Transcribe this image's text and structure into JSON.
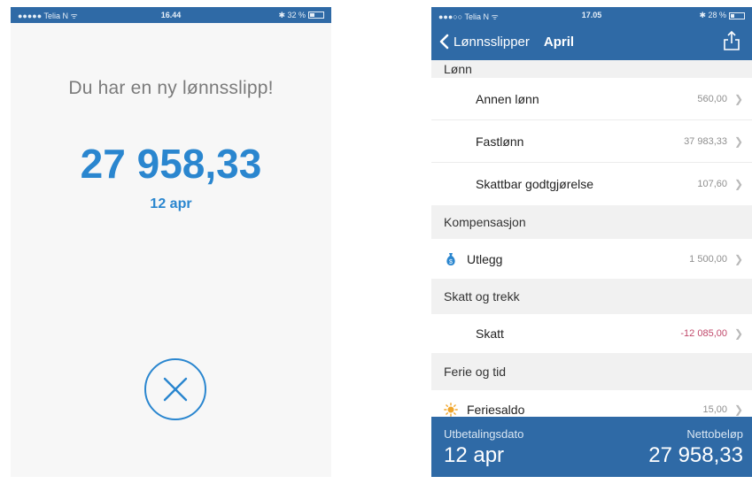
{
  "left": {
    "status": {
      "carrier": "●●●●● Telia N ᯤ",
      "time": "16.44",
      "battery": "✱ 32 %",
      "battery_level": 0.32
    },
    "message": "Du har en ny lønnsslipp!",
    "amount": "27 958,33",
    "date": "12 apr",
    "close_icon": "close-circle-icon"
  },
  "right": {
    "status": {
      "carrier": "●●●○○ Telia N ᯤ",
      "time": "17.05",
      "battery": "✱ 28 %",
      "battery_level": 0.28
    },
    "nav": {
      "back_label": "Lønnsslipper",
      "title": "April",
      "back_icon": "chevron-left-icon",
      "share_icon": "share-icon"
    },
    "sections": {
      "lonn": "Lønn",
      "kompensasjon": "Kompensasjon",
      "skatt": "Skatt og trekk",
      "ferie": "Ferie og tid"
    },
    "rows": {
      "annen_lonn": {
        "label": "Annen lønn",
        "value": "560,00"
      },
      "fastlonn": {
        "label": "Fastlønn",
        "value": "37 983,33"
      },
      "godtgjorelse": {
        "label": "Skattbar godtgjørelse",
        "value": "107,60"
      },
      "utlegg": {
        "label": "Utlegg",
        "value": "1 500,00",
        "icon": "money-bag-icon"
      },
      "skatt": {
        "label": "Skatt",
        "value": "-12 085,00"
      },
      "feriesaldo": {
        "label": "Feriesaldo",
        "value": "15,00",
        "icon": "sun-icon"
      }
    },
    "footer": {
      "date_label": "Utbetalingsdato",
      "date_value": "12 apr",
      "net_label": "Nettobeløp",
      "net_value": "27 958,33"
    }
  },
  "colors": {
    "brand_blue": "#2f6aa6",
    "accent_blue": "#2a86cf",
    "negative": "#c0486a",
    "sun": "#f0a52a"
  }
}
